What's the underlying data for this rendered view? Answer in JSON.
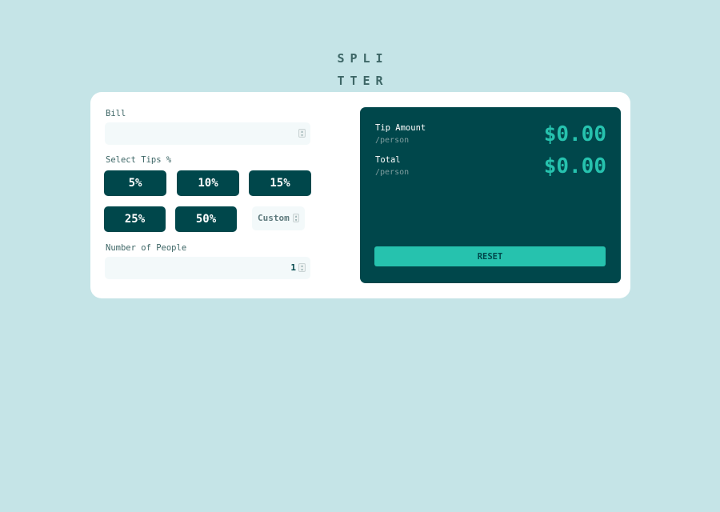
{
  "logo": {
    "line1": "SPLI",
    "line2": "TTER"
  },
  "form": {
    "bill_label": "Bill",
    "bill_value": "",
    "tips_label": "Select Tips %",
    "tip_options": [
      "5%",
      "10%",
      "15%",
      "25%",
      "50%"
    ],
    "custom_placeholder": "Custom",
    "people_label": "Number of People",
    "people_value": "1"
  },
  "results": {
    "tip_label": "Tip Amount",
    "tip_sub": "/person",
    "tip_value": "$0.00",
    "total_label": "Total",
    "total_sub": "/person",
    "total_value": "$0.00",
    "reset_label": "RESET"
  },
  "colors": {
    "background": "#c5e4e7",
    "card": "#ffffff",
    "dark_cyan": "#00474b",
    "strong_cyan": "#26c2ae",
    "input_bg": "#f3f9fa",
    "grayish_cyan": "#7f9d9f"
  },
  "icons": {
    "spinner": "up-down-arrows-icon"
  }
}
